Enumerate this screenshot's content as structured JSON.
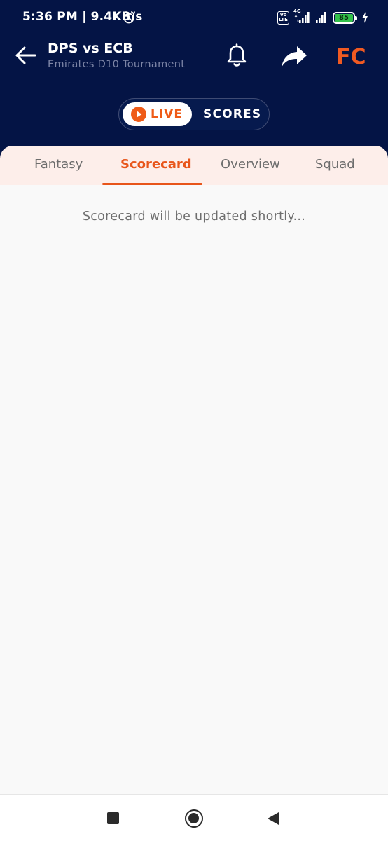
{
  "status_bar": {
    "time": "5:36 PM | 9.4KB/s",
    "volte_top": "Vo",
    "volte_bottom": "LTE",
    "network_type": "4G",
    "battery_level": "85",
    "icons": [
      "alarm-icon",
      "volte-icon",
      "signal-icon",
      "signal-icon",
      "battery-icon",
      "charging-icon"
    ]
  },
  "app_bar": {
    "title": "DPS vs ECB",
    "subtitle": "Emirates D10 Tournament",
    "icons": [
      "back-arrow-icon",
      "bell-icon",
      "share-icon",
      "fc-logo-icon"
    ],
    "logo_text": "FC"
  },
  "live_toggle": {
    "live_label": "LIVE",
    "scores_label": "SCORES",
    "live_color": "#ef5b17"
  },
  "tabs": [
    {
      "label": "Fantasy",
      "active": false
    },
    {
      "label": "Scorecard",
      "active": true
    },
    {
      "label": "Overview",
      "active": false
    },
    {
      "label": "Squad",
      "active": false
    }
  ],
  "content": {
    "message": "Scorecard will be updated shortly..."
  },
  "nav_bar": {
    "icons": [
      "recents-square-icon",
      "home-circle-icon",
      "back-triangle-icon"
    ]
  },
  "colors": {
    "header_bg": "#041445",
    "accent": "#e8551a",
    "tab_bar_bg": "#fdeeea",
    "page_bg": "#f9f9f9",
    "battery_green": "#33c24a"
  }
}
